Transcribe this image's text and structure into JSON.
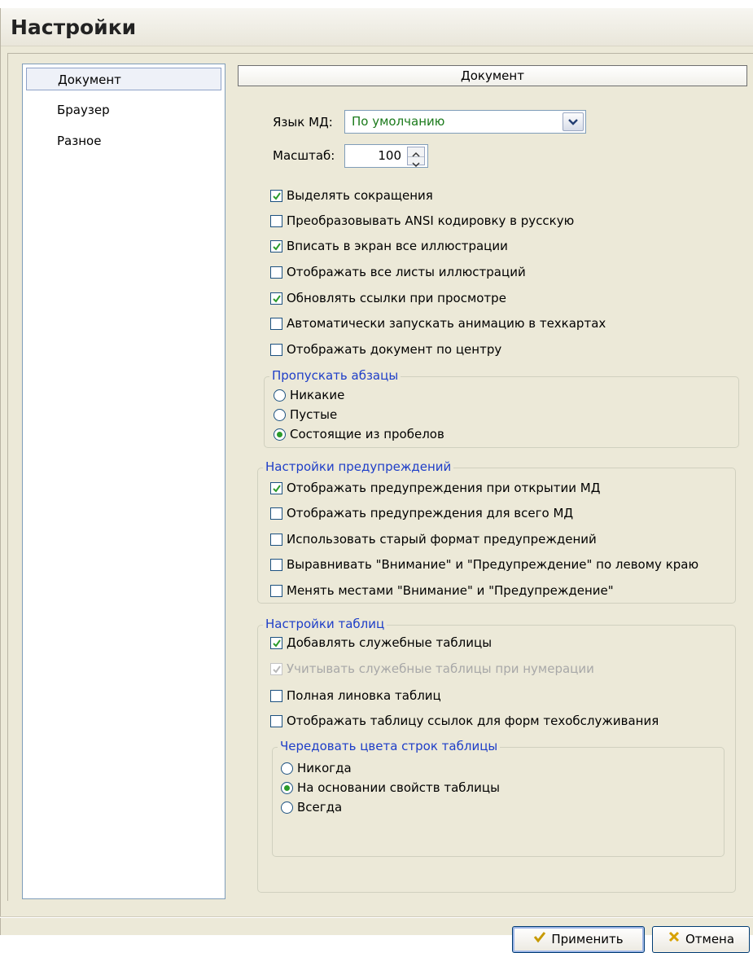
{
  "dialog": {
    "title": "Настройки",
    "sidebar": {
      "items": [
        {
          "label": "Документ",
          "selected": true
        },
        {
          "label": "Браузер",
          "selected": false
        },
        {
          "label": "Разное",
          "selected": false
        }
      ]
    },
    "section_title": "Документ",
    "language": {
      "label": "Язык МД:",
      "value": "По умолчанию"
    },
    "scale": {
      "label": "Масштаб:",
      "value": "100"
    },
    "checkboxes": [
      {
        "label": "Выделять сокращения",
        "checked": true
      },
      {
        "label": "Преобразовывать ANSI кодировку в русскую",
        "checked": false
      },
      {
        "label": "Вписать в экран все иллюстрации",
        "checked": true
      },
      {
        "label": "Отображать все листы иллюстраций",
        "checked": false
      },
      {
        "label": "Обновлять ссылки при просмотре",
        "checked": true
      },
      {
        "label": "Автоматически запускать анимацию в техкартах",
        "checked": false
      },
      {
        "label": "Отображать документ по центру",
        "checked": false
      }
    ],
    "skip_paragraphs": {
      "title": "Пропускать абзацы",
      "options": [
        {
          "label": "Никакие",
          "selected": false
        },
        {
          "label": "Пустые",
          "selected": false
        },
        {
          "label": "Состоящие из пробелов",
          "selected": true
        }
      ]
    },
    "warnings": {
      "title": "Настройки предупреждений",
      "checkboxes": [
        {
          "label": "Отображать предупреждения при открытии МД",
          "checked": true
        },
        {
          "label": "Отображать предупреждения для всего МД",
          "checked": false
        },
        {
          "label": "Использовать старый формат предупреждений",
          "checked": false
        },
        {
          "label": "Выравнивать \"Внимание\" и \"Предупреждение\" по левому краю",
          "checked": false
        },
        {
          "label": "Менять местами \"Внимание\" и \"Предупреждение\"",
          "checked": false
        }
      ]
    },
    "tables": {
      "title": "Настройки таблиц",
      "checkboxes": [
        {
          "label": "Добавлять служебные таблицы",
          "checked": true,
          "disabled": false
        },
        {
          "label": "Учитывать служебные таблицы при нумерации",
          "checked": true,
          "disabled": true
        },
        {
          "label": "Полная линовка таблиц",
          "checked": false,
          "disabled": false
        },
        {
          "label": "Отображать таблицу ссылок для форм техобслуживания",
          "checked": false,
          "disabled": false
        }
      ],
      "alternate": {
        "title": "Чередовать цвета строк таблицы",
        "options": [
          {
            "label": "Никогда",
            "selected": false
          },
          {
            "label": "На основании свойств таблицы",
            "selected": true
          },
          {
            "label": "Всегда",
            "selected": false
          }
        ]
      }
    },
    "buttons": {
      "apply": "Применить",
      "cancel": "Отмена"
    }
  },
  "colors": {
    "accent_title": "#1e3ec8",
    "value_text": "#1b7a1b",
    "check_mark": "#2b9b2b"
  }
}
